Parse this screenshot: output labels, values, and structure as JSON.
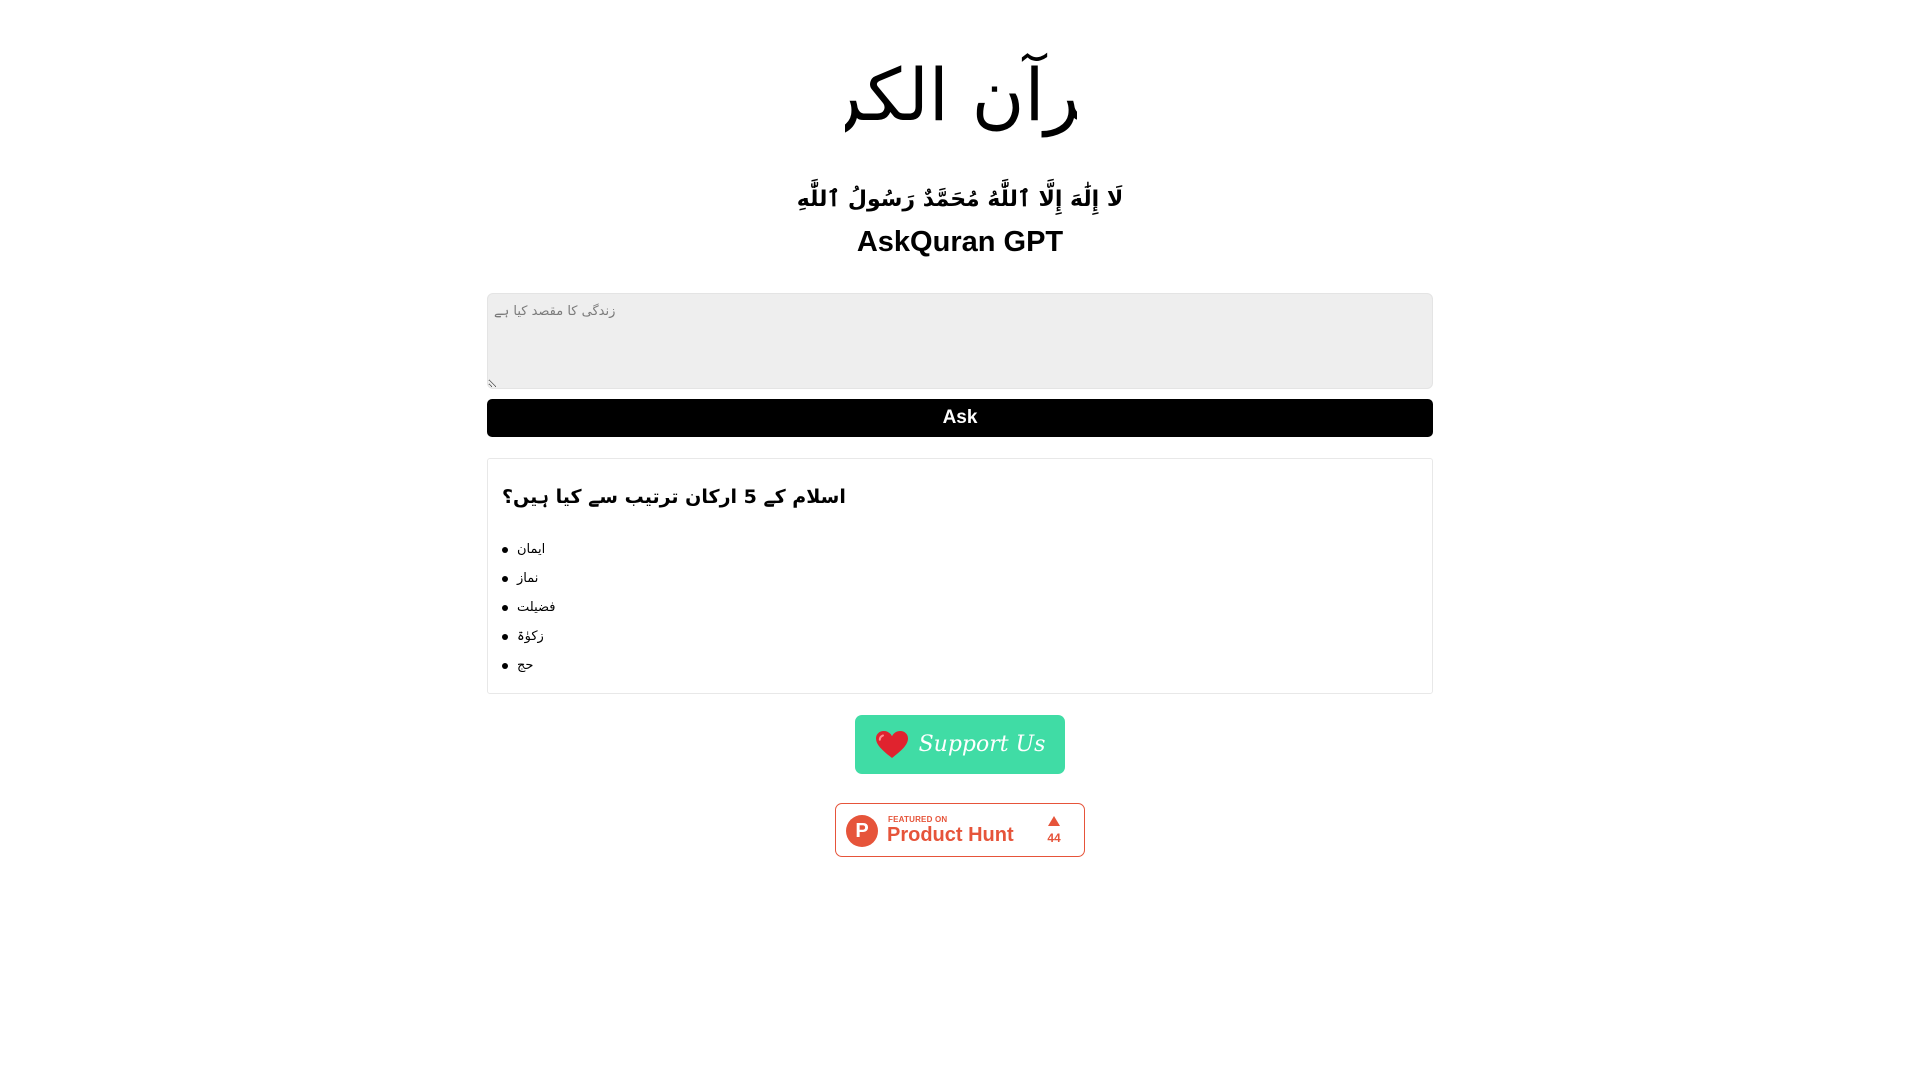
{
  "header": {
    "logo_text": "القرآن الكريم",
    "shahada": "لَا إِلَٰهَ إِلَّا ٱللَّٰهُ مُحَمَّدٌ رَسُولُ ٱللَّٰهِ",
    "app_title": "AskQuran GPT"
  },
  "question": {
    "placeholder": "زندگی کا مقصد کیا ہے",
    "value": ""
  },
  "ask_button": {
    "label": "Ask"
  },
  "answer": {
    "title": "اسلام کے 5 ارکان ترتیب سے کیا ہیں؟",
    "items": [
      "ایمان",
      "نماز",
      "فضیلت",
      "زکوٰۃ",
      "حج"
    ]
  },
  "support": {
    "label": "Support Us",
    "icon": "heart-icon",
    "background": "#40dca5"
  },
  "product_hunt": {
    "featured_label": "FEATURED ON",
    "name": "Product Hunt",
    "upvotes": "44",
    "logo_letter": "P",
    "color": "#e6543a"
  }
}
